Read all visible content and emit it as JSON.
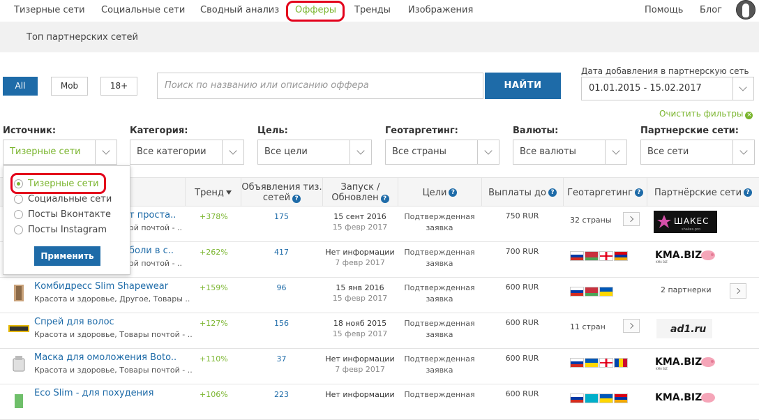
{
  "nav": {
    "items": [
      "Тизерные сети",
      "Социальные сети",
      "Сводный анализ",
      "Офферы",
      "Тренды",
      "Изображения"
    ],
    "right": [
      "Помощь",
      "Блог"
    ],
    "active": "Офферы"
  },
  "subnav": {
    "label": "Топ партнерских сетей"
  },
  "search": {
    "buttons": [
      "All",
      "Mob",
      "18+"
    ],
    "placeholder": "Поиск по названию или описанию оффера",
    "submit": "НАЙТИ",
    "date_label": "Дата добавления в партнерскую сеть",
    "date_value": "01.01.2015 - 15.02.2017",
    "clear_filters": "Очистить фильтры"
  },
  "filters": [
    {
      "label": "Источник:",
      "value": "Тизерные сети"
    },
    {
      "label": "Категория:",
      "value": "Все категории"
    },
    {
      "label": "Цель:",
      "value": "Все цели"
    },
    {
      "label": "Геотаргетинг:",
      "value": "Все страны"
    },
    {
      "label": "Валюты:",
      "value": "Все валюты"
    },
    {
      "label": "Партнерские сети:",
      "value": "Все сети"
    }
  ],
  "source_dropdown": {
    "options": [
      "Тизерные сети",
      "Социальные сети",
      "Посты Вконтакте",
      "Посты Instagram"
    ],
    "selected": "Тизерные сети",
    "apply": "Применить"
  },
  "table": {
    "headers": {
      "trend": "Тренд",
      "ads_1": "Объявления тиз.",
      "ads_2": "сетей",
      "launch_1": "Запуск /",
      "launch_2": "Обновлен",
      "goals": "Цели",
      "payout": "Выплаты до",
      "geo": "Геотаргетинг",
      "partners": "Партнёрские сети"
    },
    "rows": [
      {
        "name": "т проста..",
        "category": "ой почтой - ..",
        "trend": "+378%",
        "ads": "175",
        "launch": "15 сент 2016",
        "updated": "15 февр 2017",
        "goal_1": "Подтвержденная",
        "goal_2": "заявка",
        "payout": "750 RUR",
        "geo": "32 страны",
        "partner": "ШАКЕС",
        "partner_sub": "shakes.pro"
      },
      {
        "name": "боли в с..",
        "category": "ой почтой - ..",
        "trend": "+262%",
        "ads": "417",
        "launch": "Нет информации",
        "updated": "7 февр 2017",
        "goal_1": "Подтвержденная",
        "goal_2": "заявка",
        "payout": "700 RUR",
        "geo": "",
        "partner": "KMA.BIZ",
        "partner_sub": "KMA BIZ"
      },
      {
        "name": "Комбидресс Slim Shapewear",
        "category": "Красота и здоровье, Другое, Товары ..",
        "trend": "+159%",
        "ads": "96",
        "launch": "15 янв 2016",
        "updated": "15 февр 2017",
        "goal_1": "Подтвержденная",
        "goal_2": "заявка",
        "payout": "600 RUR",
        "geo": "",
        "partner": "2 партнерки",
        "partner_sub": ""
      },
      {
        "name": "Спрей для волос",
        "category": "Красота и здоровье, Товары почтой - ..",
        "trend": "+127%",
        "ads": "156",
        "launch": "18 нояб 2015",
        "updated": "15 февр 2017",
        "goal_1": "Подтвержденная",
        "goal_2": "заявка",
        "payout": "600 RUR",
        "geo": "11 стран",
        "partner": "ad1.ru",
        "partner_sub": ""
      },
      {
        "name": "Маска для омоложения Boto..",
        "category": "Красота и здоровье, Товары почтой - ..",
        "trend": "+110%",
        "ads": "37",
        "launch": "Нет информации",
        "updated": "7 февр 2017",
        "goal_1": "Подтвержденная",
        "goal_2": "заявка",
        "payout": "600 RUR",
        "geo": "",
        "partner": "KMA.BIZ",
        "partner_sub": "KMA BIZ"
      },
      {
        "name": "Eco Slim - для похудения",
        "category": "",
        "trend": "+106%",
        "ads": "223",
        "launch": "Нет информации",
        "updated": "",
        "goal_1": "Подтвержденная",
        "goal_2": "",
        "payout": "600 RUR",
        "geo": "",
        "partner": "KMA.BIZ",
        "partner_sub": "KMA BIZ"
      }
    ]
  },
  "colors": {
    "accent_green": "#7ab52e",
    "brand_blue": "#1e6ba8",
    "highlight_red": "#e3001b"
  }
}
